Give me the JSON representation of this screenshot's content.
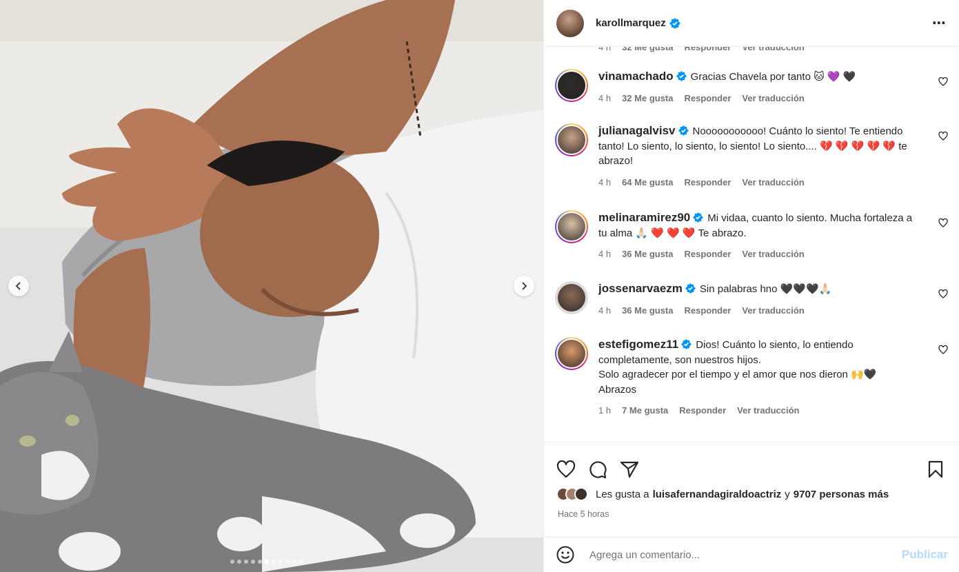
{
  "post": {
    "author": "karollmarquez",
    "more_icon": "⋯"
  },
  "carousel": {
    "total": 11,
    "active_index": 5
  },
  "partial_row": {
    "time": "4 h",
    "likes": "32 Me gusta",
    "reply": "Responder",
    "translate": "Ver traducción"
  },
  "comments": [
    {
      "user": "vinamachado",
      "text": "Gracias Chavela por tanto 🐱 💜 🖤",
      "time": "4 h",
      "likes": "32 Me gusta",
      "reply": "Responder",
      "translate": "Ver traducción",
      "avatar_color": "#2b2b2b"
    },
    {
      "user": "julianagalvisv",
      "text": "Nooooooooooo! Cuánto lo siento! Te entiendo tanto! Lo siento, lo siento, lo siento! Lo siento.... 💔 💔 💔 💔 💔  te abrazo!",
      "time": "4 h",
      "likes": "64 Me gusta",
      "reply": "Responder",
      "translate": "Ver traducción",
      "avatar_color": "#c8a48a"
    },
    {
      "user": "melinaramirez90",
      "text": "Mi vidaa, cuanto lo siento. Mucha fortaleza a tu alma 🙏🏻 ❤️ ❤️ ❤️  Te abrazo.",
      "time": "4 h",
      "likes": "36 Me gusta",
      "reply": "Responder",
      "translate": "Ver traducción",
      "avatar_color": "#d8c2a8"
    },
    {
      "user": "jossenarvaezm",
      "text": "Sin palabras hno 🖤🖤🖤🙏🏻",
      "time": "4 h",
      "likes": "36 Me gusta",
      "reply": "Responder",
      "translate": "Ver traducción",
      "avatar_color": "#8a6a58"
    },
    {
      "user": "estefigomez11",
      "text": "Dios! Cuánto lo siento, lo entiendo completamente, son nuestros hijos.\nSolo agradecer por el tiempo y el amor que nos dieron 🙌🖤\nAbrazos",
      "time": "1 h",
      "likes": "7 Me gusta",
      "reply": "Responder",
      "translate": "Ver traducción",
      "avatar_color": "#d99a6a"
    }
  ],
  "likes_line": {
    "prefix": "Les gusta a",
    "liker": "luisafernandagiraldoactriz",
    "conj": "y",
    "others": "9707 personas más"
  },
  "posted": "Hace 5 horas",
  "add_comment": {
    "placeholder": "Agrega un comentario...",
    "publish": "Publicar"
  },
  "icons": {
    "heart": "heart-icon",
    "comment": "comment-icon",
    "share": "share-icon",
    "save": "bookmark-icon",
    "emoji": "emoji-icon",
    "verified": "verified-badge-icon"
  },
  "colors": {
    "verified": "#0095f6",
    "muted": "#737373",
    "publish_disabled": "#b3dbff"
  }
}
